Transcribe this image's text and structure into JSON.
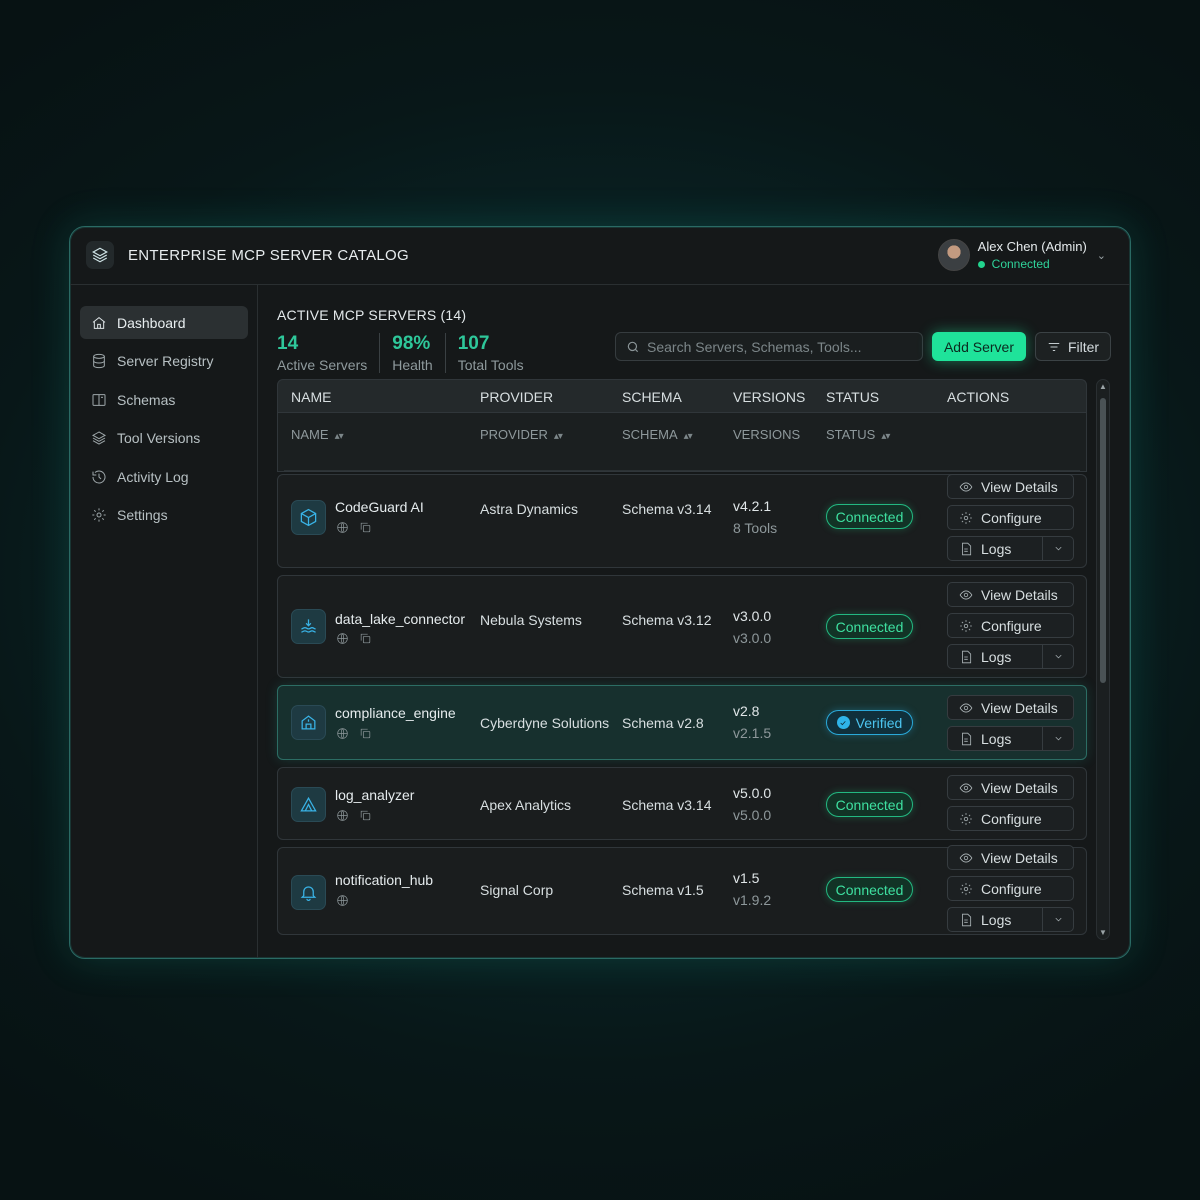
{
  "app": {
    "title": "ENTERPRISE MCP SERVER CATALOG"
  },
  "user": {
    "name": "Alex Chen (Admin)",
    "status": "Connected"
  },
  "sidebar": {
    "items": [
      {
        "label": "Dashboard",
        "icon": "home-icon",
        "active": true
      },
      {
        "label": "Server Registry",
        "icon": "database-icon"
      },
      {
        "label": "Schemas",
        "icon": "book-icon"
      },
      {
        "label": "Tool Versions",
        "icon": "layers-icon"
      },
      {
        "label": "Activity Log",
        "icon": "history-icon"
      },
      {
        "label": "Settings",
        "icon": "gear-icon"
      }
    ]
  },
  "main": {
    "section_title": "ACTIVE MCP SERVERS (14)",
    "stats": [
      {
        "value": "14",
        "label": "Active Servers"
      },
      {
        "value": "98%",
        "label": "Health"
      },
      {
        "value": "107",
        "label": "Total Tools"
      }
    ],
    "search": {
      "placeholder": "Search Servers, Schemas, Tools..."
    },
    "add_button": "Add Server",
    "filter_button": "Filter"
  },
  "table": {
    "headers": [
      "NAME",
      "PROVIDER",
      "SCHEMA",
      "VERSIONS",
      "STATUS",
      "ACTIONS"
    ],
    "subheaders": [
      "NAME",
      "PROVIDER",
      "SCHEMA",
      "VERSIONS",
      "STATUS"
    ],
    "actions": {
      "view": "View Details",
      "configure": "Configure",
      "logs": "Logs"
    },
    "rows": [
      {
        "name": "CodeGuard AI",
        "provider": "Astra Dynamics",
        "schema": "Schema v3.14",
        "version": "v4.2.1",
        "version_sub": "8 Tools",
        "status": "Connected",
        "icon": "cube-icon"
      },
      {
        "name": "data_lake_connector",
        "provider": "Nebula Systems",
        "schema": "Schema v3.12",
        "version": "v3.0.0",
        "version_sub": "v3.0.0",
        "status": "Connected",
        "icon": "waves-icon"
      },
      {
        "name": "compliance_engine",
        "provider": "Cyberdyne Solutions",
        "schema": "Schema v2.8",
        "version": "v2.8",
        "version_sub": "v2.1.5",
        "status": "Verified",
        "icon": "building-icon"
      },
      {
        "name": "log_analyzer",
        "provider": "Apex Analytics",
        "schema": "Schema v3.14",
        "version": "v5.0.0",
        "version_sub": "v5.0.0",
        "status": "Connected",
        "icon": "triangle-icon"
      },
      {
        "name": "notification_hub",
        "provider": "Signal Corp",
        "schema": "Schema v1.5",
        "version": "v1.5",
        "version_sub": "v1.9.2",
        "status": "Connected",
        "icon": "bell-icon"
      }
    ]
  },
  "colors": {
    "accent": "#1fe39a",
    "verified": "#2fb3e8",
    "border_glow": "#2a6a64"
  }
}
